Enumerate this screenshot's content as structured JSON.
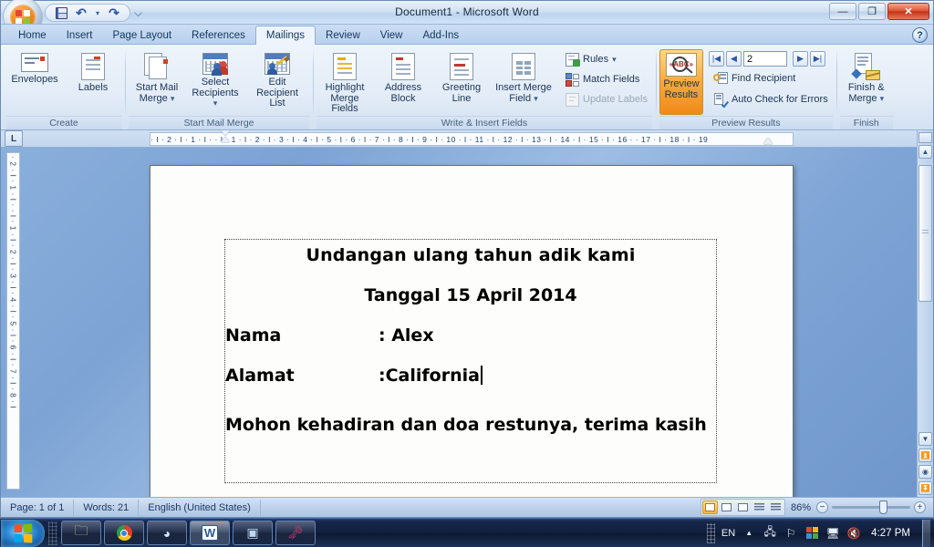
{
  "window": {
    "title": "Document1 - Microsoft Word",
    "minimize_label": "—",
    "restore_label": "❐",
    "close_label": "✕"
  },
  "quick_access": {
    "save_label": "save-icon",
    "undo_label": "↶",
    "undo_more_label": "▾",
    "redo_label": "↷",
    "customize_label": "⌵"
  },
  "tabs": [
    {
      "label": "Home",
      "active": false
    },
    {
      "label": "Insert",
      "active": false
    },
    {
      "label": "Page Layout",
      "active": false
    },
    {
      "label": "References",
      "active": false
    },
    {
      "label": "Mailings",
      "active": true
    },
    {
      "label": "Review",
      "active": false
    },
    {
      "label": "View",
      "active": false
    },
    {
      "label": "Add-Ins",
      "active": false
    }
  ],
  "help_label": "?",
  "ribbon": {
    "groups": [
      {
        "name": "Create",
        "label": "Create",
        "buttons": [
          {
            "label": "Envelopes"
          },
          {
            "label": "Labels"
          }
        ]
      },
      {
        "name": "Start Mail Merge",
        "label": "Start Mail Merge",
        "buttons": [
          {
            "label": "Start Mail\nMerge",
            "line1": "Start Mail",
            "line2": "Merge",
            "dropdown": true
          },
          {
            "label": "Select Recipients",
            "line1": "Select",
            "line2": "Recipients",
            "dropdown": true
          },
          {
            "label": "Edit Recipient List",
            "line1": "Edit",
            "line2": "Recipient List",
            "dropdown": false
          }
        ]
      },
      {
        "name": "Write & Insert Fields",
        "label": "Write & Insert Fields",
        "buttons": [
          {
            "label": "Highlight Merge Fields",
            "line1": "Highlight",
            "line2": "Merge Fields",
            "dropdown": false
          },
          {
            "label": "Address Block",
            "line1": "Address",
            "line2": "Block",
            "dropdown": false
          },
          {
            "label": "Greeting Line",
            "line1": "Greeting",
            "line2": "Line",
            "dropdown": false
          },
          {
            "label": "Insert Merge Field",
            "line1": "Insert Merge",
            "line2": "Field",
            "dropdown": true
          }
        ],
        "small_buttons": [
          {
            "label": "Rules",
            "dropdown": true,
            "disabled": false
          },
          {
            "label": "Match Fields",
            "dropdown": false,
            "disabled": false
          },
          {
            "label": "Update Labels",
            "dropdown": false,
            "disabled": true
          }
        ]
      },
      {
        "name": "Preview Results",
        "label": "Preview Results",
        "buttons": [
          {
            "label": "Preview Results",
            "line1": "Preview",
            "line2": "Results",
            "active": true
          }
        ],
        "record_navigator": {
          "first_label": "⏮",
          "prev_label": "◀",
          "value": "2",
          "next_label": "▶",
          "last_label": "⏭"
        },
        "small_buttons": [
          {
            "label": "Find Recipient",
            "disabled": false
          },
          {
            "label": "Auto Check for Errors",
            "disabled": false
          }
        ]
      },
      {
        "name": "Finish",
        "label": "Finish",
        "buttons": [
          {
            "label": "Finish & Merge",
            "line1": "Finish &",
            "line2": "Merge",
            "dropdown": true
          }
        ]
      }
    ]
  },
  "ruler": {
    "tab_selector_label": "L",
    "horizontal_ticks": "· I · 2 · I · 1 · I ·      · I · 1 · I · 2 · I · 3 · I · 4 · I · 5 · I · 6 · I · 7 · I · 8 · I · 9 · I · 10 · I · 11 · I · 12 · I · 13 · I · 14 · I · 15 · I · 16 ·      · 17 · I · 18 · I · 19",
    "vertical_ticks": "· 2 · I · 1 · I ·   · I · 1 · I · 2 · I · 3 · I · 4 · I · 5 · I · 6 · I · 7 · I · 8 · I"
  },
  "document": {
    "title_line": "Undangan ulang tahun adik kami",
    "date_line": "Tanggal 15 April 2014",
    "fields": [
      {
        "key": "Nama",
        "value": ": Alex"
      },
      {
        "key": "Alamat",
        "value": ":California"
      }
    ],
    "closing_line": "Mohon kehadiran dan doa restunya, terima kasih"
  },
  "statusbar": {
    "page_label": "Page: 1 of 1",
    "words_label": "Words: 21",
    "language_label": "English (United States)",
    "zoom_label": "86%",
    "zoom_out_label": "−",
    "zoom_in_label": "+",
    "view_buttons": [
      {
        "name": "print-layout",
        "active": true
      },
      {
        "name": "full-screen-reading",
        "active": false
      },
      {
        "name": "web-layout",
        "active": false
      },
      {
        "name": "outline",
        "active": false
      },
      {
        "name": "draft",
        "active": false
      }
    ]
  },
  "taskbar": {
    "start_label": "Start",
    "items": [
      {
        "name": "windows-explorer",
        "glyph": "🗀"
      },
      {
        "name": "google-chrome",
        "glyph": "◉"
      },
      {
        "name": "media-player",
        "glyph": "◕"
      },
      {
        "name": "microsoft-word",
        "glyph": "W"
      },
      {
        "name": "photo-viewer",
        "glyph": "▣"
      },
      {
        "name": "microsoft-access",
        "glyph": "🗝"
      }
    ],
    "tray": {
      "language_label": "EN",
      "show_hidden_label": "▲",
      "icons": [
        {
          "name": "network-plug-icon",
          "glyph": "⚓"
        },
        {
          "name": "action-center-flag-icon",
          "glyph": "⚑"
        },
        {
          "name": "graphics-icon",
          "glyph": "▦"
        },
        {
          "name": "network-icon",
          "glyph": "🖥"
        },
        {
          "name": "volume-muted-icon",
          "glyph": "🔇"
        }
      ],
      "clock_label": "4:27 PM"
    }
  }
}
